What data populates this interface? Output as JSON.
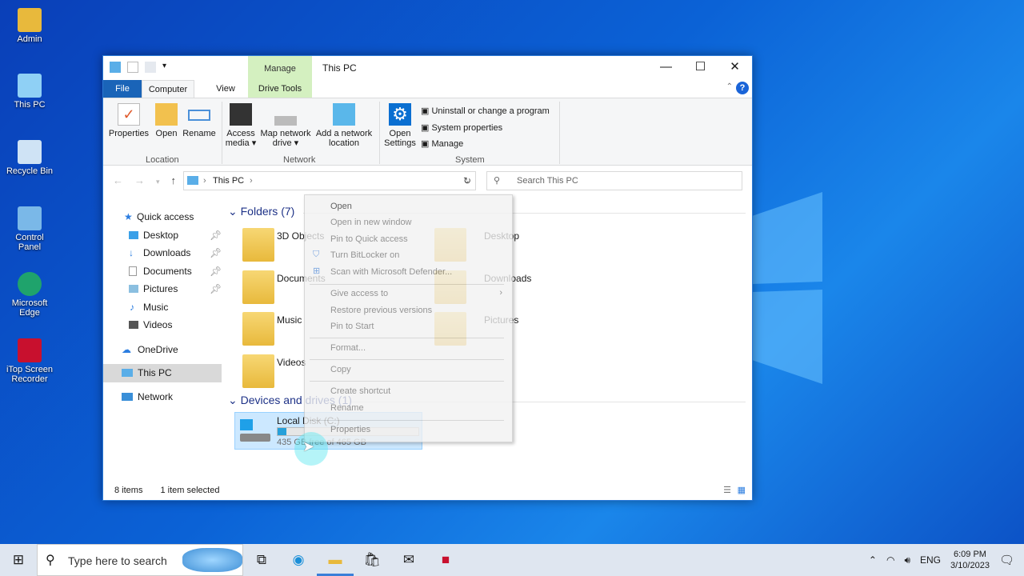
{
  "desktop": {
    "icons": [
      "Admin",
      "This PC",
      "Recycle Bin",
      "Control Panel",
      "Microsoft Edge",
      "iTop Screen Recorder"
    ]
  },
  "window": {
    "title": "This PC",
    "manage_tab": "Manage",
    "tabs": [
      "File",
      "Computer",
      "View",
      "Drive Tools"
    ],
    "ribbon": {
      "location": {
        "label": "Location",
        "buttons": [
          "Properties",
          "Open",
          "Rename"
        ]
      },
      "network": {
        "label": "Network",
        "buttons": [
          "Access media",
          "Map network drive",
          "Add a network location"
        ]
      },
      "system": {
        "label": "System",
        "open_settings": "Open Settings",
        "links": [
          "Uninstall or change a program",
          "System properties",
          "Manage"
        ]
      }
    },
    "address": "This PC",
    "search_placeholder": "Search This PC",
    "nav": [
      {
        "label": "Quick access"
      },
      {
        "label": "Desktop",
        "pinned": true
      },
      {
        "label": "Downloads",
        "pinned": true
      },
      {
        "label": "Documents",
        "pinned": true
      },
      {
        "label": "Pictures",
        "pinned": true
      },
      {
        "label": "Music"
      },
      {
        "label": "Videos"
      },
      {
        "label": "OneDrive"
      },
      {
        "label": "This PC",
        "selected": true
      },
      {
        "label": "Network"
      }
    ],
    "folders_header": "Folders (7)",
    "folders": [
      "3D Objects",
      "Documents",
      "Music",
      "Videos",
      "Desktop",
      "Downloads",
      "Pictures"
    ],
    "devices_header": "Devices and drives (1)",
    "drive": {
      "name": "Local Disk (C:)",
      "free": "435 GB free of 465 GB",
      "used_fraction": 0.065
    },
    "status": {
      "items": "8 items",
      "selected": "1 item selected"
    }
  },
  "context_menu": [
    "Open",
    "Open in new window",
    "Pin to Quick access",
    "Turn BitLocker on",
    "Scan with Microsoft Defender...",
    "Give access to",
    "Restore previous versions",
    "Pin to Start",
    "Format...",
    "Copy",
    "Create shortcut",
    "Rename",
    "Properties"
  ],
  "taskbar": {
    "search_placeholder": "Type here to search",
    "lang": "ENG",
    "time": "6:09 PM",
    "date": "3/10/2023"
  }
}
